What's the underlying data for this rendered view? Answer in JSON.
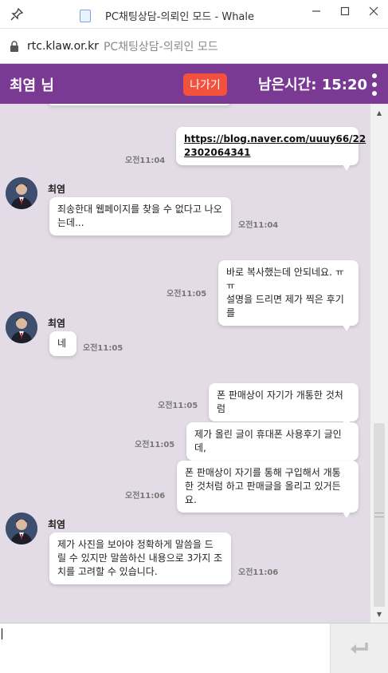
{
  "window": {
    "title": "PC채팅상담-의뢰인 모드 - Whale",
    "controls": [
      "minimize",
      "maximize",
      "close"
    ]
  },
  "urlbar": {
    "host": "rtc.klaw.or.kr",
    "page_title": "PC채팅상담-의뢰인 모드"
  },
  "header": {
    "name": "최염 님",
    "exit_label": "나가기",
    "timer": "남은시간: 15:20",
    "colors": {
      "bar": "#7a3a94",
      "exit_button": "#f2513d"
    }
  },
  "chat": {
    "background": "#e3dce6",
    "messages": [
      {
        "from": "me",
        "text": "https://blog.naver.com/uuuy66/222302064341",
        "link_line1": "https://blog.naver.com/uuuy66/22",
        "link_line2": "2302064341",
        "time": "오전11:04"
      },
      {
        "from": "other",
        "sender": "최염",
        "line1": "죄송한대 웹페이지를 찾을 수 없다고 나오",
        "line2": "는데...",
        "time": "오전11:04"
      },
      {
        "from": "me",
        "line1": "바로 복사했는데 안되네요. ㅠㅠ",
        "line2": "설명을 드리면 제가 찍은 후기를",
        "time": "오전11:05"
      },
      {
        "from": "other",
        "sender": "최염",
        "line1": "네",
        "time": "오전11:05"
      },
      {
        "from": "me",
        "line1": "폰 판매상이 자기가 개통한 것처럼",
        "time": "오전11:05"
      },
      {
        "from": "me",
        "line1": "제가 올린 글이 휴대폰 사용후기 글인데,",
        "time": "오전11:05"
      },
      {
        "from": "me",
        "line1": "폰 판매상이 자기를 통해 구입해서 개통",
        "line2": "한 것처럼 하고 판매글을 올리고 있거든요.",
        "time": "오전11:06"
      },
      {
        "from": "other",
        "sender": "최염",
        "line1": "제가 사진을 보아야 정확하게 말씀을 드",
        "line2": "릴 수 있지만 말씀하신 내용으로 3가지 조",
        "line3": "치를 고려할 수 있습니다.",
        "time": "오전11:06"
      }
    ]
  },
  "input": {
    "value": "",
    "send_icon": "enter-arrow-icon"
  }
}
